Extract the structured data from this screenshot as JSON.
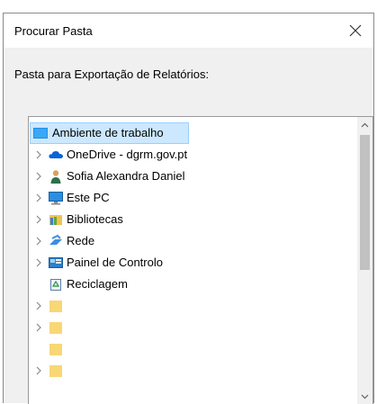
{
  "dialog": {
    "title": "Procurar Pasta",
    "close_icon": "close-icon",
    "prompt": "Pasta para Exportação de Relatórios:"
  },
  "tree": {
    "items": [
      {
        "label": "Ambiente de trabalho",
        "icon": "desktop-icon",
        "expandable": false,
        "selected": true
      },
      {
        "label": "OneDrive - dgrm.gov.pt",
        "icon": "onedrive-cloud-icon",
        "expandable": true
      },
      {
        "label": "Sofia Alexandra Daniel",
        "icon": "user-icon",
        "expandable": true
      },
      {
        "label": "Este PC",
        "icon": "computer-icon",
        "expandable": true
      },
      {
        "label": "Bibliotecas",
        "icon": "libraries-icon",
        "expandable": true
      },
      {
        "label": "Rede",
        "icon": "network-icon",
        "expandable": true
      },
      {
        "label": "Painel de Controlo",
        "icon": "control-panel-icon",
        "expandable": true
      },
      {
        "label": "Reciclagem",
        "icon": "recycle-bin-icon",
        "expandable": false
      },
      {
        "label": "",
        "icon": "folder-icon",
        "expandable": true
      },
      {
        "label": "",
        "icon": "folder-icon",
        "expandable": true
      },
      {
        "label": "",
        "icon": "folder-icon",
        "expandable": false
      },
      {
        "label": "",
        "icon": "folder-icon",
        "expandable": true
      }
    ]
  },
  "colors": {
    "selection_bg": "#cce8ff",
    "selection_border": "#99d1ff",
    "dialog_bg": "#f0f0f0",
    "folder_yellow": "#f8d775"
  }
}
